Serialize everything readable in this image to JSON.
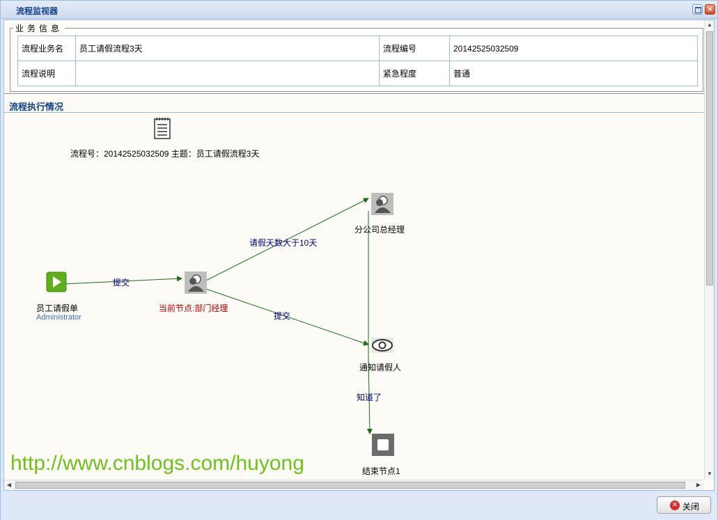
{
  "window": {
    "title": "流程监视器"
  },
  "business_info": {
    "legend": "业务信息",
    "rows": [
      {
        "label1": "流程业务名",
        "value1": "员工请假流程3天",
        "label2": "流程编号",
        "value2": "20142525032509"
      },
      {
        "label1": "流程说明",
        "value1": "",
        "label2": "紧急程度",
        "value2": "普通"
      }
    ]
  },
  "execution": {
    "title": "流程执行情况",
    "header_text": "流程号：20142525032509   主题：员工请假流程3天",
    "nodes": {
      "start": {
        "label": "员工请假单",
        "sublabel": "Administrator"
      },
      "dept": {
        "label": "当前节点:部门经理"
      },
      "gm": {
        "label": "分公司总经理"
      },
      "notify": {
        "label": "通知请假人"
      },
      "end": {
        "label": "结束节点1"
      }
    },
    "edges": {
      "start_dept": "提交",
      "dept_gm": "请假天数大于10天",
      "dept_notify": "提交",
      "notify_end": "知道了"
    },
    "colors": {
      "edge": "#1a6a1a",
      "current_node_label": "#c00000",
      "edge_label": "#000080",
      "start_icon": "#5fae1e"
    }
  },
  "watermark": "http://www.cnblogs.com/huyong",
  "footer": {
    "close_label": "关闭"
  }
}
